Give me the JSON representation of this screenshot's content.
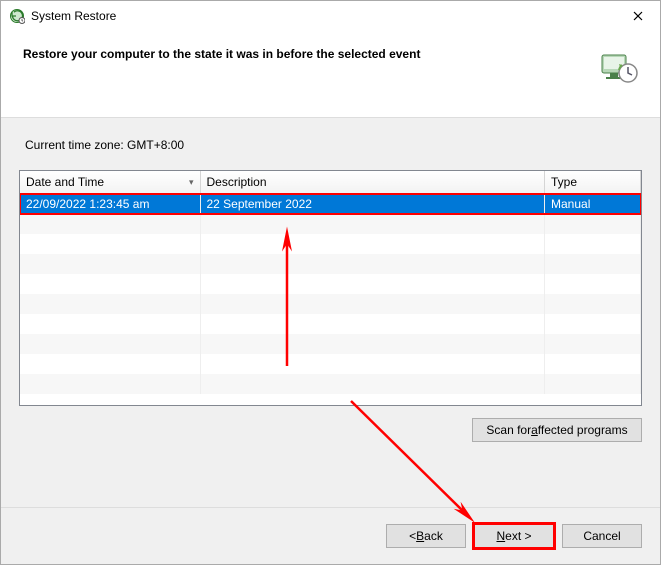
{
  "window": {
    "title": "System Restore"
  },
  "header": {
    "text": "Restore your computer to the state it was in before the selected event"
  },
  "timezone_label": "Current time zone: GMT+8:00",
  "columns": {
    "date": "Date and Time",
    "description": "Description",
    "type": "Type"
  },
  "restore_points": [
    {
      "date": "22/09/2022 1:23:45 am",
      "description": "22 September 2022",
      "type": "Manual",
      "selected": true
    }
  ],
  "buttons": {
    "scan": "Scan for affected programs",
    "scan_mnemonic_index": 9,
    "back": "< Back",
    "back_mnemonic_index": 2,
    "next": "Next >",
    "next_mnemonic_index": 0,
    "cancel": "Cancel"
  }
}
